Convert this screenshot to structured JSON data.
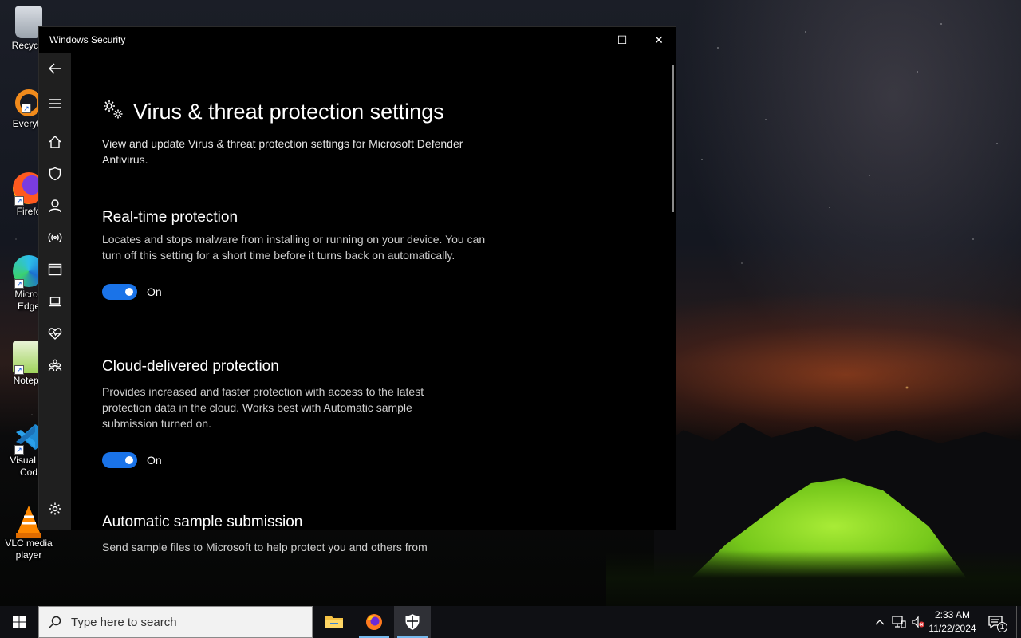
{
  "window": {
    "title": "Windows Security",
    "controls": {
      "minimize": "—",
      "maximize": "☐",
      "close": "✕"
    }
  },
  "nav": {
    "icons": [
      "back-arrow-icon",
      "hamburger-menu-icon",
      "home-icon",
      "shield-icon",
      "account-person-icon",
      "wifi-antenna-icon",
      "app-browser-window-icon",
      "laptop-device-icon",
      "heart-health-icon",
      "family-icon",
      "settings-gear-icon"
    ]
  },
  "page": {
    "title": "Virus & threat protection settings",
    "description": "View and update Virus & threat protection settings for Microsoft Defender Antivirus.",
    "sections": [
      {
        "heading": "Real-time protection",
        "text": "Locates and stops malware from installing or running on your device. You can turn off this setting for a short time before it turns back on automatically.",
        "toggle_state": "On"
      },
      {
        "heading": "Cloud-delivered protection",
        "text": "Provides increased and faster protection with access to the latest protection data in the cloud. Works best with Automatic sample submission turned on.",
        "toggle_state": "On"
      },
      {
        "heading": "Automatic sample submission",
        "text": "Send sample files to Microsoft to help protect you and others from"
      }
    ]
  },
  "desktop": {
    "icons": [
      {
        "label": "Recycle",
        "icon": "recycle-bin-icon"
      },
      {
        "label": "Everyth",
        "icon": "everything-search-icon"
      },
      {
        "label": "Firefo",
        "icon": "firefox-icon"
      },
      {
        "label": "Micros\nEdge",
        "icon": "edge-icon"
      },
      {
        "label": "Notepa",
        "icon": "notepad-plus-plus-icon"
      },
      {
        "label": "Visual St\nCod",
        "icon": "vscode-icon"
      },
      {
        "label": "VLC media\nplayer",
        "icon": "vlc-icon"
      }
    ]
  },
  "taskbar": {
    "search_placeholder": "Type here to search",
    "time": "2:33 AM",
    "date": "11/22/2024",
    "notification_count": "1"
  },
  "colors": {
    "accent": "#1a73e8",
    "window_bg": "#000000",
    "nav_bg": "#1f1f1f"
  }
}
